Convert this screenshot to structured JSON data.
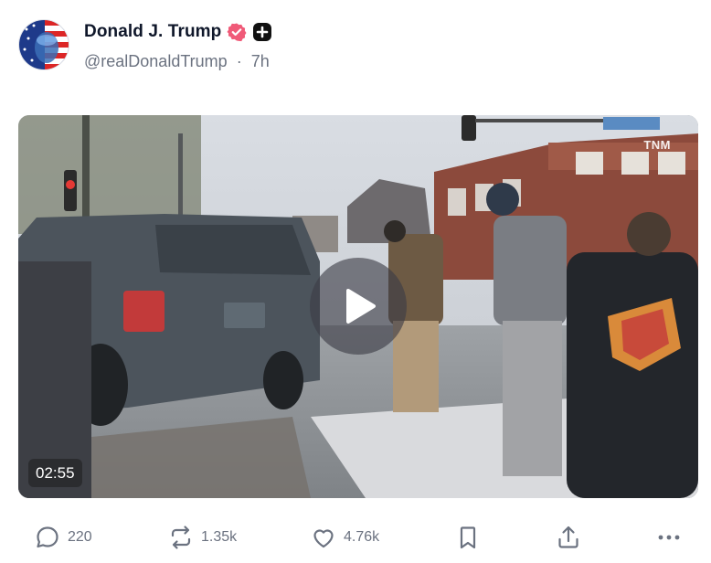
{
  "post": {
    "author": {
      "display_name": "Donald J. Trump",
      "handle": "@realDonaldTrump",
      "separator": "·",
      "time_ago": "7h",
      "verified_icon": "verified-badge-icon",
      "plus_icon": "plus-badge-icon"
    },
    "video": {
      "duration": "02:55",
      "watermark": "TNM",
      "play_icon": "play-icon"
    },
    "actions": {
      "replies": "220",
      "reposts": "1.35k",
      "likes": "4.76k"
    }
  },
  "colors": {
    "verified": "#f05a78",
    "text_primary": "#0f172a",
    "text_secondary": "#6b7280"
  }
}
